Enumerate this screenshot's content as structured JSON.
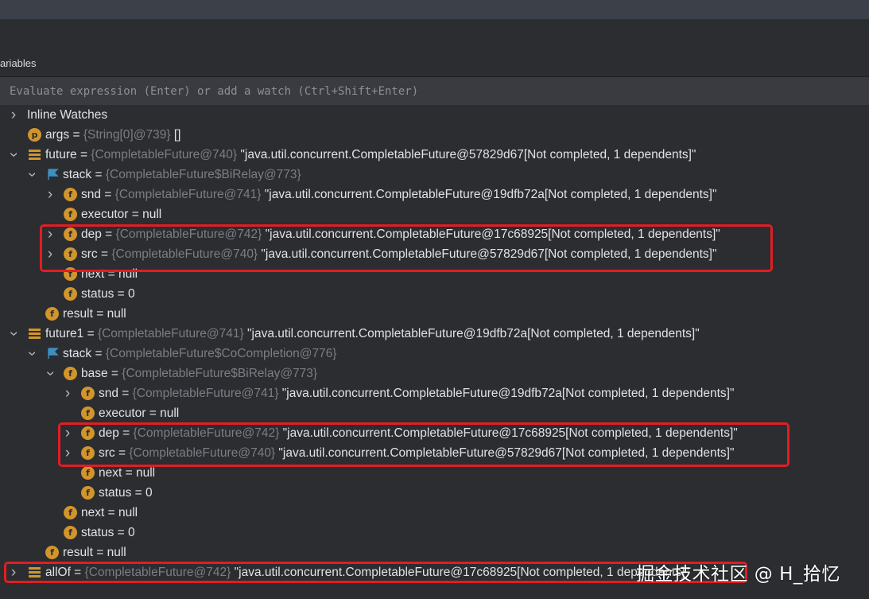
{
  "panel": {
    "title": "ariables"
  },
  "evaluate": {
    "placeholder": "Evaluate expression (Enter) or add a watch (Ctrl+Shift+Enter)"
  },
  "tree": {
    "r0": {
      "name": "Inline Watches"
    },
    "r1": {
      "name": "args",
      "eq": " = ",
      "ref": "{String[0]@739}",
      "val": " []"
    },
    "r2": {
      "name": "future",
      "eq": " = ",
      "ref": "{CompletableFuture@740}",
      "val": " \"java.util.concurrent.CompletableFuture@57829d67[Not completed, 1 dependents]\""
    },
    "r3": {
      "name": "stack",
      "eq": " = ",
      "ref": "{CompletableFuture$BiRelay@773}"
    },
    "r4": {
      "name": "snd",
      "eq": " = ",
      "ref": "{CompletableFuture@741}",
      "val": " \"java.util.concurrent.CompletableFuture@19dfb72a[Not completed, 1 dependents]\""
    },
    "r5": {
      "name": "executor",
      "eq": " = ",
      "val": "null"
    },
    "r6": {
      "name": "dep",
      "eq": " = ",
      "ref": "{CompletableFuture@742}",
      "val": " \"java.util.concurrent.CompletableFuture@17c68925[Not completed, 1 dependents]\""
    },
    "r7": {
      "name": "src",
      "eq": " = ",
      "ref": "{CompletableFuture@740}",
      "val": " \"java.util.concurrent.CompletableFuture@57829d67[Not completed, 1 dependents]\""
    },
    "r8": {
      "name": "next",
      "eq": " = ",
      "val": "null"
    },
    "r9": {
      "name": "status",
      "eq": " = ",
      "val": "0"
    },
    "r10": {
      "name": "result",
      "eq": " = ",
      "val": "null"
    },
    "r11": {
      "name": "future1",
      "eq": " = ",
      "ref": "{CompletableFuture@741}",
      "val": " \"java.util.concurrent.CompletableFuture@19dfb72a[Not completed, 1 dependents]\""
    },
    "r12": {
      "name": "stack",
      "eq": " = ",
      "ref": "{CompletableFuture$CoCompletion@776}"
    },
    "r13": {
      "name": "base",
      "eq": " = ",
      "ref": "{CompletableFuture$BiRelay@773}"
    },
    "r14": {
      "name": "snd",
      "eq": " = ",
      "ref": "{CompletableFuture@741}",
      "val": " \"java.util.concurrent.CompletableFuture@19dfb72a[Not completed, 1 dependents]\""
    },
    "r15": {
      "name": "executor",
      "eq": " = ",
      "val": "null"
    },
    "r16": {
      "name": "dep",
      "eq": " = ",
      "ref": "{CompletableFuture@742}",
      "val": " \"java.util.concurrent.CompletableFuture@17c68925[Not completed, 1 dependents]\""
    },
    "r17": {
      "name": "src",
      "eq": " = ",
      "ref": "{CompletableFuture@740}",
      "val": " \"java.util.concurrent.CompletableFuture@57829d67[Not completed, 1 dependents]\""
    },
    "r18": {
      "name": "next",
      "eq": " = ",
      "val": "null"
    },
    "r19": {
      "name": "status",
      "eq": " = ",
      "val": "0"
    },
    "r20": {
      "name": "next",
      "eq": " = ",
      "val": "null"
    },
    "r21": {
      "name": "status",
      "eq": " = ",
      "val": "0"
    },
    "r22": {
      "name": "result",
      "eq": " = ",
      "val": "null"
    },
    "r23": {
      "name": "allOf",
      "eq": " = ",
      "ref": "{CompletableFuture@742}",
      "val": " \"java.util.concurrent.CompletableFuture@17c68925[Not completed, 1 dependents]\""
    }
  },
  "watermark": "掘金技术社区 @ H_拾忆",
  "colors": {
    "highlight": "#e21d23",
    "field_icon": "#d2952b",
    "flag_icon": "#3d8fbf"
  }
}
